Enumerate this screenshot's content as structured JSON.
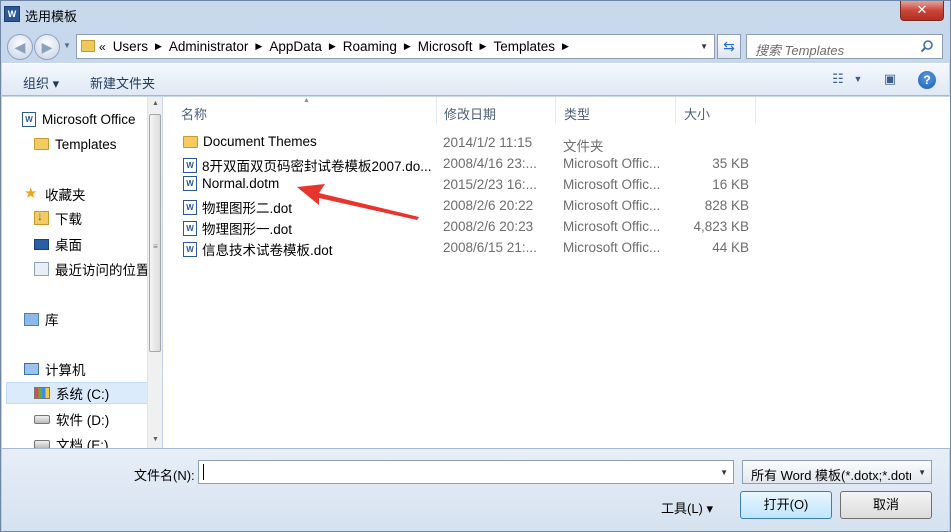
{
  "window": {
    "title": "选用模板",
    "app_icon": "word-icon",
    "close_label": "✕"
  },
  "address": {
    "overflow": "«",
    "crumbs": [
      "Users",
      "Administrator",
      "AppData",
      "Roaming",
      "Microsoft",
      "Templates"
    ],
    "search_placeholder": "搜索 Templates"
  },
  "toolbar": {
    "organize_label": "组织 ▾",
    "new_folder_label": "新建文件夹"
  },
  "sidebar": {
    "items": [
      {
        "label": "Microsoft Office",
        "icon": "word-icon"
      },
      {
        "label": "Templates",
        "icon": "folder-icon"
      },
      {
        "label": "收藏夹",
        "icon": "star-icon"
      },
      {
        "label": "下载",
        "icon": "download-folder-icon"
      },
      {
        "label": "桌面",
        "icon": "desktop-icon"
      },
      {
        "label": "最近访问的位置",
        "icon": "recent-places-icon"
      },
      {
        "label": "库",
        "icon": "library-icon"
      },
      {
        "label": "计算机",
        "icon": "computer-icon"
      },
      {
        "label": "系统 (C:)",
        "icon": "windows-drive-icon",
        "selected": true
      },
      {
        "label": "软件 (D:)",
        "icon": "drive-icon"
      },
      {
        "label": "文档 (E:)",
        "icon": "drive-icon"
      }
    ]
  },
  "columns": {
    "name": "名称",
    "date": "修改日期",
    "type": "类型",
    "size": "大小"
  },
  "files": [
    {
      "name": "Document Themes",
      "date": "2014/1/2 11:15",
      "type": "文件夹",
      "size": "",
      "icon": "folder-icon"
    },
    {
      "name": "8开双面双页码密封试卷模板2007.do...",
      "date": "2008/4/16 23:...",
      "type": "Microsoft Offic...",
      "size": "35 KB",
      "icon": "word-doc-icon"
    },
    {
      "name": "Normal.dotm",
      "date": "2015/2/23 16:...",
      "type": "Microsoft Offic...",
      "size": "16 KB",
      "icon": "word-doc-icon"
    },
    {
      "name": "物理图形二.dot",
      "date": "2008/2/6 20:22",
      "type": "Microsoft Offic...",
      "size": "828 KB",
      "icon": "word-doc-icon"
    },
    {
      "name": "物理图形一.dot",
      "date": "2008/2/6 20:23",
      "type": "Microsoft Offic...",
      "size": "4,823 KB",
      "icon": "word-doc-icon"
    },
    {
      "name": "信息技术试卷模板.dot",
      "date": "2008/6/15 21:...",
      "type": "Microsoft Offic...",
      "size": "44 KB",
      "icon": "word-doc-icon"
    }
  ],
  "bottom": {
    "filename_label": "文件名(N):",
    "filename_value": "",
    "filetype_value": "所有 Word 模板(*.dotx;*.dotm",
    "tools_label": "工具(L)  ▾",
    "open_label": "打开(O)",
    "cancel_label": "取消"
  },
  "colors": {
    "annotation_arrow": "#e8342c",
    "window_frame": "#c9d9ec"
  }
}
